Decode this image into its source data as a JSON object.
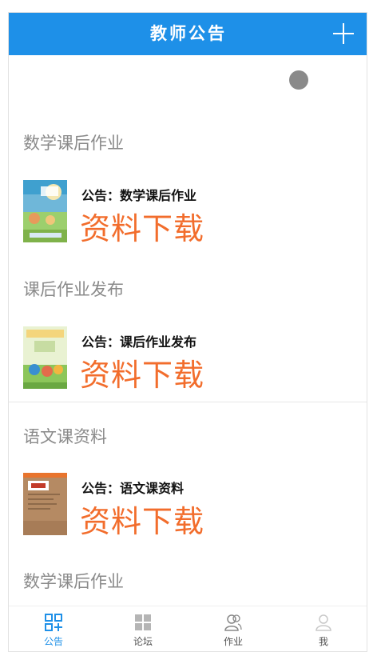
{
  "header": {
    "title": "教师公告",
    "add_icon": "plus-icon"
  },
  "sections": [
    {
      "title": "数学课后作业",
      "label": "公告：数学课后作业",
      "download": "资料下载",
      "thumb": "math-book-cover"
    },
    {
      "title": "课后作业发布",
      "label": "公告：课后作业发布",
      "download": "资料下载",
      "thumb": "ethics-book-cover"
    },
    {
      "title": "语文课资料",
      "label": "公告：语文课资料",
      "download": "资料下载",
      "thumb": "chinese-book-cover"
    },
    {
      "title": "数学课后作业"
    }
  ],
  "tabs": [
    {
      "label": "公告",
      "icon": "notice-grid-icon",
      "active": true
    },
    {
      "label": "论坛",
      "icon": "forum-grid-icon",
      "active": false
    },
    {
      "label": "作业",
      "icon": "users-icon",
      "active": false
    },
    {
      "label": "我",
      "icon": "person-icon",
      "active": false
    }
  ],
  "colors": {
    "accent": "#1e90e8",
    "download_text": "#f26d2c",
    "section_title": "#8a8a8a"
  }
}
